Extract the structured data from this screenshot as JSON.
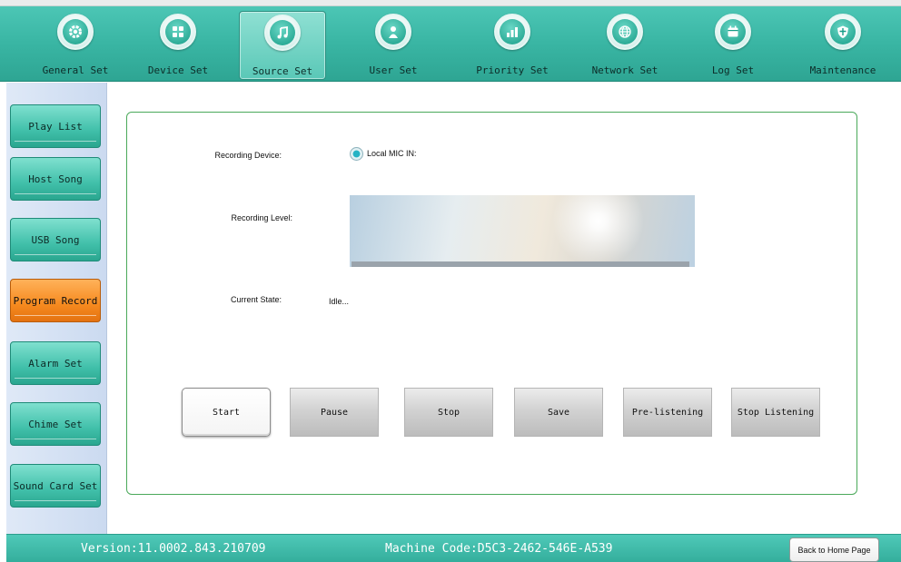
{
  "nav": {
    "tabs": [
      {
        "label": "General Set",
        "icon": "gear-icon"
      },
      {
        "label": "Device Set",
        "icon": "device-icon"
      },
      {
        "label": "Source Set",
        "icon": "music-note-icon",
        "active": true
      },
      {
        "label": "User Set",
        "icon": "user-icon"
      },
      {
        "label": "Priority Set",
        "icon": "bar-chart-icon"
      },
      {
        "label": "Network Set",
        "icon": "globe-icon"
      },
      {
        "label": "Log Set",
        "icon": "calendar-icon"
      },
      {
        "label": "Maintenance",
        "icon": "shield-icon"
      }
    ]
  },
  "sidebar": {
    "items": [
      {
        "label": "Play List"
      },
      {
        "label": "Host Song"
      },
      {
        "label": "USB Song"
      },
      {
        "label": "Program Record",
        "active": true
      },
      {
        "label": "Alarm Set"
      },
      {
        "label": "Chime Set"
      },
      {
        "label": "Sound Card Set"
      }
    ]
  },
  "recording": {
    "device_label": "Recording Device:",
    "device_option": "Local MIC IN:",
    "device_selected": true,
    "level_label": "Recording Level:",
    "state_label": "Current State:",
    "state_value": "Idle..."
  },
  "controls": {
    "start": "Start",
    "pause": "Pause",
    "stop": "Stop",
    "save": "Save",
    "prelisten": "Pre-listening",
    "stop_listening": "Stop Listening"
  },
  "footer": {
    "version": "Version:11.0002.843.210709",
    "machine_code": "Machine Code:D5C3-2462-546E-A539",
    "back_home": "Back to Home Page"
  },
  "colors": {
    "teal_accent": "#3bbba8",
    "active_orange": "#f68a1f",
    "panel_border": "#4aa95a"
  }
}
